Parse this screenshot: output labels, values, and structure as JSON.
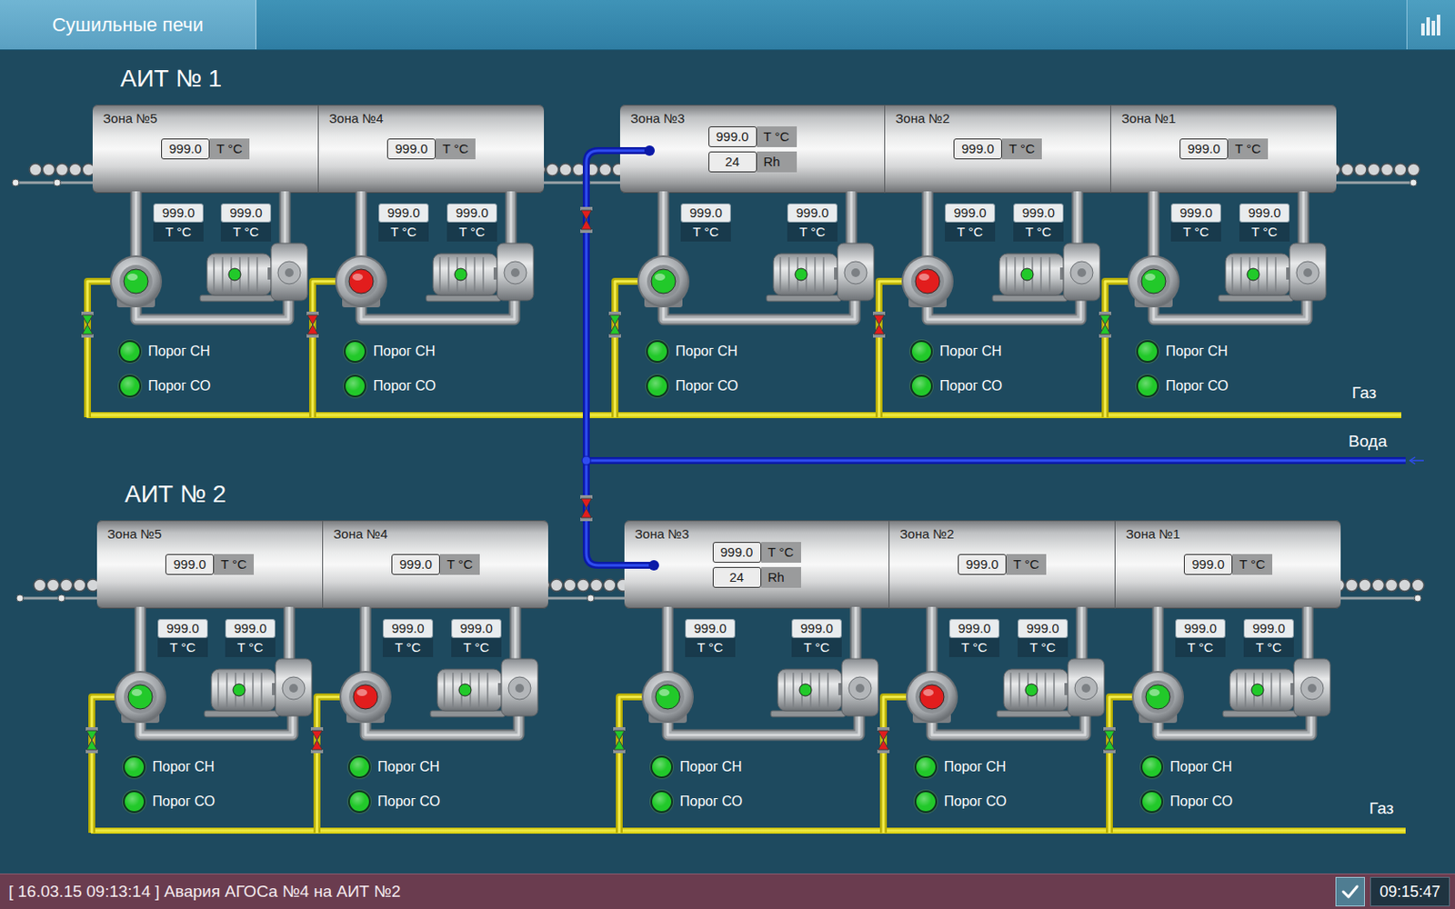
{
  "header": {
    "tab": {
      "label": "Сушильные печи",
      "selected": true
    }
  },
  "plants": [
    {
      "title": "АИТ № 1",
      "gas_label": "Газ",
      "sections": [
        {
          "zones": [
            {
              "name": "Зона №5",
              "readings": [
                {
                  "value": "999.0",
                  "unit": "T °C"
                }
              ],
              "sensors": [
                {
                  "value": "999.0",
                  "unit": "T °C"
                },
                {
                  "value": "999.0",
                  "unit": "T °C"
                }
              ],
              "burner_color": "#22c92a",
              "motor_color": "#22c92a",
              "valve_open": true,
              "thresholds": [
                {
                  "label": "Порог СН",
                  "color": "#22c92a"
                },
                {
                  "label": "Порог СО",
                  "color": "#22c92a"
                }
              ]
            },
            {
              "name": "Зона №4",
              "readings": [
                {
                  "value": "999.0",
                  "unit": "T °C"
                }
              ],
              "sensors": [
                {
                  "value": "999.0",
                  "unit": "T °C"
                },
                {
                  "value": "999.0",
                  "unit": "T °C"
                }
              ],
              "burner_color": "#e21d1d",
              "motor_color": "#22c92a",
              "valve_open": false,
              "thresholds": [
                {
                  "label": "Порог СН",
                  "color": "#22c92a"
                },
                {
                  "label": "Порог СО",
                  "color": "#22c92a"
                }
              ]
            }
          ]
        },
        {
          "zones": [
            {
              "name": "Зона №3",
              "readings": [
                {
                  "value": "999.0",
                  "unit": "T °C"
                },
                {
                  "value": "24",
                  "unit": "Rh"
                }
              ],
              "sensors": [
                {
                  "value": "999.0",
                  "unit": "T °C"
                },
                {
                  "value": "999.0",
                  "unit": "T °C"
                }
              ],
              "burner_color": "#22c92a",
              "motor_color": "#22c92a",
              "valve_open": true,
              "thresholds": [
                {
                  "label": "Порог СН",
                  "color": "#22c92a"
                },
                {
                  "label": "Порог СО",
                  "color": "#22c92a"
                }
              ]
            },
            {
              "name": "Зона №2",
              "readings": [
                {
                  "value": "999.0",
                  "unit": "T °C"
                }
              ],
              "sensors": [
                {
                  "value": "999.0",
                  "unit": "T °C"
                },
                {
                  "value": "999.0",
                  "unit": "T °C"
                }
              ],
              "burner_color": "#e21d1d",
              "motor_color": "#22c92a",
              "valve_open": false,
              "thresholds": [
                {
                  "label": "Порог СН",
                  "color": "#22c92a"
                },
                {
                  "label": "Порог СО",
                  "color": "#22c92a"
                }
              ]
            },
            {
              "name": "Зона №1",
              "readings": [
                {
                  "value": "999.0",
                  "unit": "T °C"
                }
              ],
              "sensors": [
                {
                  "value": "999.0",
                  "unit": "T °C"
                },
                {
                  "value": "999.0",
                  "unit": "T °C"
                }
              ],
              "burner_color": "#22c92a",
              "motor_color": "#22c92a",
              "valve_open": true,
              "thresholds": [
                {
                  "label": "Порог СН",
                  "color": "#22c92a"
                },
                {
                  "label": "Порог СО",
                  "color": "#22c92a"
                }
              ]
            }
          ]
        }
      ]
    },
    {
      "title": "АИТ № 2",
      "gas_label": "Газ",
      "sections": [
        {
          "zones": [
            {
              "name": "Зона №5",
              "readings": [
                {
                  "value": "999.0",
                  "unit": "T °C"
                }
              ],
              "sensors": [
                {
                  "value": "999.0",
                  "unit": "T °C"
                },
                {
                  "value": "999.0",
                  "unit": "T °C"
                }
              ],
              "burner_color": "#22c92a",
              "motor_color": "#22c92a",
              "valve_open": true,
              "thresholds": [
                {
                  "label": "Порог СН",
                  "color": "#22c92a"
                },
                {
                  "label": "Порог СО",
                  "color": "#22c92a"
                }
              ]
            },
            {
              "name": "Зона №4",
              "readings": [
                {
                  "value": "999.0",
                  "unit": "T °C"
                }
              ],
              "sensors": [
                {
                  "value": "999.0",
                  "unit": "T °C"
                },
                {
                  "value": "999.0",
                  "unit": "T °C"
                }
              ],
              "burner_color": "#e21d1d",
              "motor_color": "#22c92a",
              "valve_open": false,
              "thresholds": [
                {
                  "label": "Порог СН",
                  "color": "#22c92a"
                },
                {
                  "label": "Порог СО",
                  "color": "#22c92a"
                }
              ]
            }
          ]
        },
        {
          "zones": [
            {
              "name": "Зона №3",
              "readings": [
                {
                  "value": "999.0",
                  "unit": "T °C"
                },
                {
                  "value": "24",
                  "unit": "Rh"
                }
              ],
              "sensors": [
                {
                  "value": "999.0",
                  "unit": "T °C"
                },
                {
                  "value": "999.0",
                  "unit": "T °C"
                }
              ],
              "burner_color": "#22c92a",
              "motor_color": "#22c92a",
              "valve_open": true,
              "thresholds": [
                {
                  "label": "Порог СН",
                  "color": "#22c92a"
                },
                {
                  "label": "Порог СО",
                  "color": "#22c92a"
                }
              ]
            },
            {
              "name": "Зона №2",
              "readings": [
                {
                  "value": "999.0",
                  "unit": "T °C"
                }
              ],
              "sensors": [
                {
                  "value": "999.0",
                  "unit": "T °C"
                },
                {
                  "value": "999.0",
                  "unit": "T °C"
                }
              ],
              "burner_color": "#e21d1d",
              "motor_color": "#22c92a",
              "valve_open": false,
              "thresholds": [
                {
                  "label": "Порог СН",
                  "color": "#22c92a"
                },
                {
                  "label": "Порог СО",
                  "color": "#22c92a"
                }
              ]
            },
            {
              "name": "Зона №1",
              "readings": [
                {
                  "value": "999.0",
                  "unit": "T °C"
                }
              ],
              "sensors": [
                {
                  "value": "999.0",
                  "unit": "T °C"
                },
                {
                  "value": "999.0",
                  "unit": "T °C"
                }
              ],
              "burner_color": "#22c92a",
              "motor_color": "#22c92a",
              "valve_open": true,
              "thresholds": [
                {
                  "label": "Порог СН",
                  "color": "#22c92a"
                },
                {
                  "label": "Порог СО",
                  "color": "#22c92a"
                }
              ]
            }
          ]
        }
      ]
    }
  ],
  "water": {
    "label": "Вода",
    "valves": [
      {
        "open": false
      },
      {
        "open": false
      }
    ]
  },
  "status_bar": {
    "message": "[ 16.03.15 09:13:14 ] Авария АГОСа №4 на АИТ №2",
    "time": "09:15:47"
  }
}
